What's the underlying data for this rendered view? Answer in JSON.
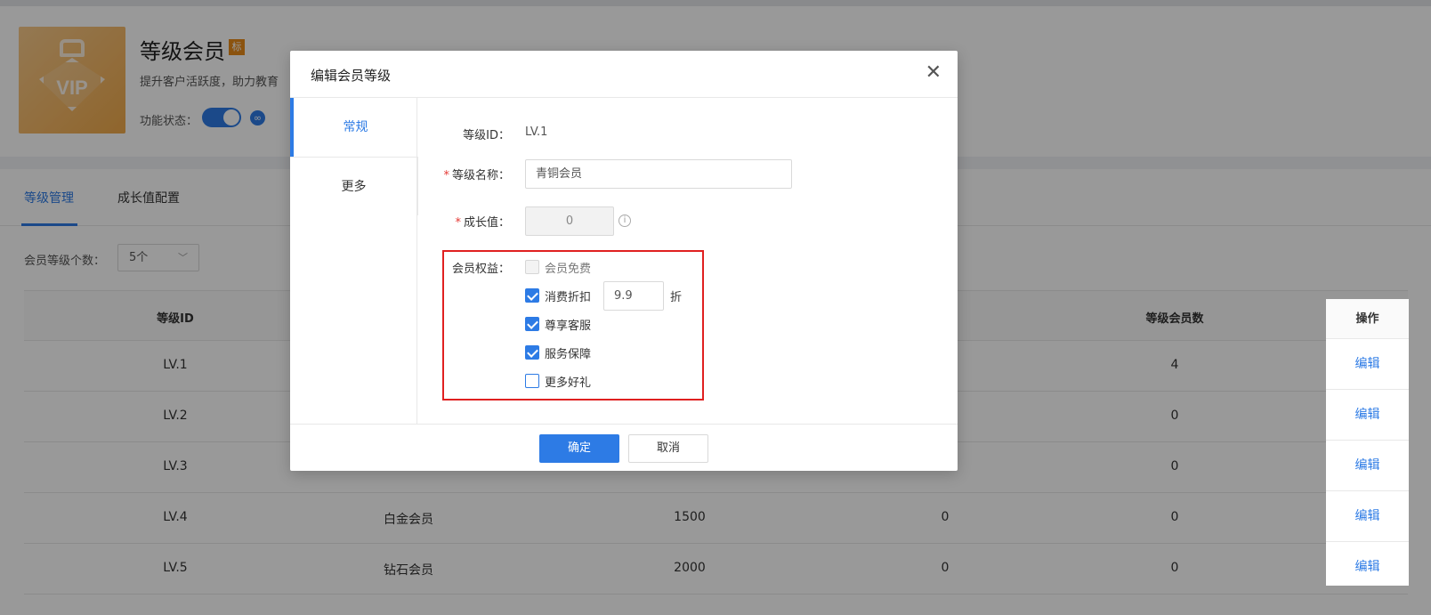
{
  "app": {
    "title": "等级会员",
    "badge": "标",
    "description": "提升客户活跃度，助力教育",
    "status_label": "功能状态：",
    "logo_text": "VIP"
  },
  "tabs": [
    {
      "label": "等级管理",
      "active": true
    },
    {
      "label": "成长值配置",
      "active": false
    }
  ],
  "level_count": {
    "label": "会员等级个数：",
    "value": "5个"
  },
  "table": {
    "headers": [
      "等级ID",
      "等级会员数",
      "操作"
    ],
    "rows": [
      {
        "id": "LV.1",
        "name": "",
        "growth": "",
        "col4": "",
        "members": "4",
        "action": "编辑"
      },
      {
        "id": "LV.2",
        "name": "",
        "growth": "",
        "col4": "",
        "members": "0",
        "action": "编辑"
      },
      {
        "id": "LV.3",
        "name": "",
        "growth": "",
        "col4": "",
        "members": "0",
        "action": "编辑"
      },
      {
        "id": "LV.4",
        "name": "白金会员",
        "growth": "1500",
        "col4": "0",
        "members": "0",
        "action": "编辑"
      },
      {
        "id": "LV.5",
        "name": "钻石会员",
        "growth": "2000",
        "col4": "0",
        "members": "0",
        "action": "编辑"
      }
    ]
  },
  "modal": {
    "title": "编辑会员等级",
    "side_nav": [
      "常规",
      "更多"
    ],
    "fields": {
      "level_id_label": "等级ID：",
      "level_id_value": "LV.1",
      "name_label": "等级名称：",
      "name_value": "青铜会员",
      "growth_label": "成长值：",
      "growth_value": "0",
      "benefits_label": "会员权益："
    },
    "benefits": [
      {
        "label": "会员免费",
        "state": "disabled"
      },
      {
        "label": "消费折扣",
        "state": "checked",
        "input_value": "9.9",
        "suffix": "折"
      },
      {
        "label": "尊享客服",
        "state": "checked"
      },
      {
        "label": "服务保障",
        "state": "checked"
      },
      {
        "label": "更多好礼",
        "state": "unchecked"
      }
    ],
    "confirm_label": "确定",
    "cancel_label": "取消"
  },
  "colors": {
    "accent": "#2d7be5",
    "highlight": "#e02020",
    "badge": "#e88a1a"
  }
}
